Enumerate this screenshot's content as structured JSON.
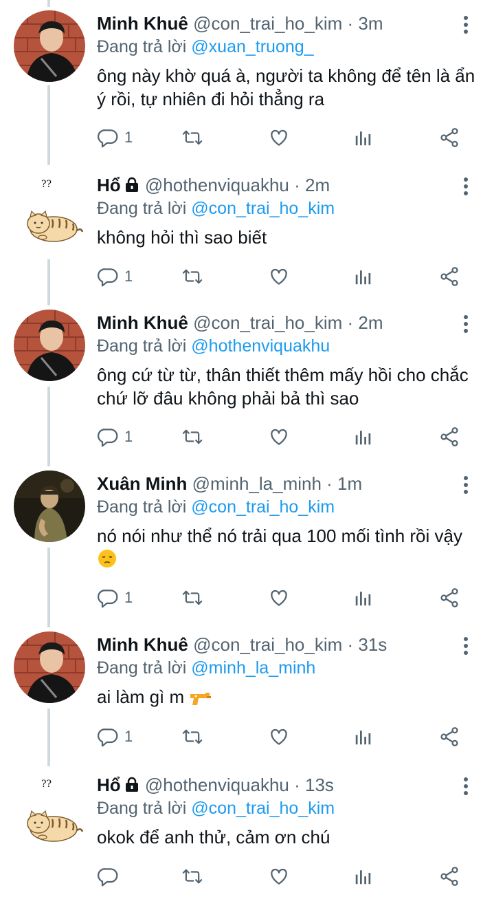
{
  "reply_prefix": "Đang trả lời",
  "tweets": [
    {
      "name": "Minh Khuê",
      "handle": "@con_trai_ho_kim",
      "sep": "·",
      "time": "3m",
      "mention": "@xuan_truong_",
      "text": "ông này khờ quá à, người ta không để tên là ẩn ý rồi, tự nhiên đi hỏi thẳng ra",
      "reply_count": "1",
      "avatar": "photo-guy"
    },
    {
      "name": "Hổ",
      "handle": "@hothenviquakhu",
      "sep": "·",
      "time": "2m",
      "mention": "@con_trai_ho_kim",
      "text": "không hỏi thì sao biết",
      "reply_count": "1",
      "avatar": "tiger",
      "badge": "??"
    },
    {
      "name": "Minh Khuê",
      "handle": "@con_trai_ho_kim",
      "sep": "·",
      "time": "2m",
      "mention": "@hothenviquakhu",
      "text": "ông cứ từ từ, thân thiết thêm mấy hồi cho chắc chứ lỡ đâu không phải bả thì sao",
      "reply_count": "1",
      "avatar": "photo-guy"
    },
    {
      "name": "Xuân Minh",
      "handle": "@minh_la_minh",
      "sep": "·",
      "time": "1m",
      "mention": "@con_trai_ho_kim",
      "text": "nó nói như thể nó trải qua 100 mối tình rồi vậy",
      "reply_count": "1",
      "avatar": "photo-girl",
      "emoji": "pensive-face"
    },
    {
      "name": "Minh Khuê",
      "handle": "@con_trai_ho_kim",
      "sep": "·",
      "time": "31s",
      "mention": "@minh_la_minh",
      "text": "ai làm gì m",
      "reply_count": "1",
      "avatar": "photo-guy",
      "emoji": "water-pistol"
    },
    {
      "name": "Hổ",
      "handle": "@hothenviquakhu",
      "sep": "·",
      "time": "13s",
      "mention": "@con_trai_ho_kim",
      "text": "okok để anh thử, cảm ơn chú",
      "reply_count": "",
      "avatar": "tiger",
      "badge": "??"
    }
  ],
  "colors": {
    "link": "#1d9bf0",
    "muted": "#536471",
    "text": "#0f1419",
    "thread_line": "#cfd9de"
  }
}
